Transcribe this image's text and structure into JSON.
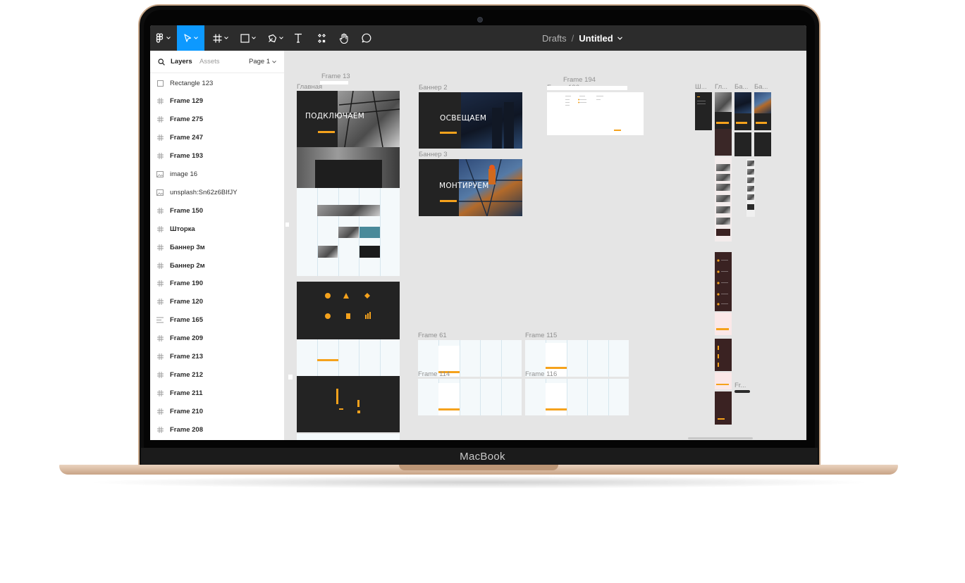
{
  "device": {
    "chin_label": "MacBook"
  },
  "toolbar": {
    "tools": [
      {
        "name": "main-menu",
        "icon": "figma-logo-icon",
        "has_dropdown": true
      },
      {
        "name": "move",
        "icon": "cursor-arrow-icon",
        "has_dropdown": true,
        "active": true
      },
      {
        "name": "frame",
        "icon": "frame-hash-icon",
        "has_dropdown": true
      },
      {
        "name": "shape",
        "icon": "rectangle-icon",
        "has_dropdown": true
      },
      {
        "name": "pen",
        "icon": "pen-icon",
        "has_dropdown": true
      },
      {
        "name": "text",
        "icon": "text-t-icon",
        "has_dropdown": false
      },
      {
        "name": "resources",
        "icon": "components-icon",
        "has_dropdown": false
      },
      {
        "name": "hand",
        "icon": "hand-icon",
        "has_dropdown": false
      },
      {
        "name": "comment",
        "icon": "comment-bubble-icon",
        "has_dropdown": false
      }
    ],
    "breadcrumb": {
      "folder": "Drafts",
      "separator": "/",
      "file": "Untitled"
    },
    "active_color": "#0d99ff"
  },
  "panel": {
    "tab_layers": "Layers",
    "tab_assets": "Assets",
    "page_selector": "Page 1",
    "layers": [
      {
        "name": "Rectangle 123",
        "icon": "rectangle-icon",
        "bold": false
      },
      {
        "name": "Frame 129",
        "icon": "frame-hash-icon",
        "bold": true
      },
      {
        "name": "Frame 275",
        "icon": "frame-hash-icon",
        "bold": true
      },
      {
        "name": "Frame 247",
        "icon": "frame-hash-icon",
        "bold": true
      },
      {
        "name": "Frame 193",
        "icon": "frame-hash-icon",
        "bold": true
      },
      {
        "name": "image 16",
        "icon": "image-icon",
        "bold": false
      },
      {
        "name": "unsplash:Sn62z6BIfJY",
        "icon": "image-icon",
        "bold": false
      },
      {
        "name": "Frame 150",
        "icon": "frame-hash-icon",
        "bold": true
      },
      {
        "name": "Шторка",
        "icon": "frame-hash-icon",
        "bold": true
      },
      {
        "name": "Баннер 3м",
        "icon": "frame-hash-icon",
        "bold": true
      },
      {
        "name": "Баннер 2м",
        "icon": "frame-hash-icon",
        "bold": true
      },
      {
        "name": "Frame 190",
        "icon": "frame-hash-icon",
        "bold": true
      },
      {
        "name": "Frame 120",
        "icon": "frame-hash-icon",
        "bold": true
      },
      {
        "name": "Frame 165",
        "icon": "auto-layout-icon",
        "bold": true
      },
      {
        "name": "Frame 209",
        "icon": "frame-hash-icon",
        "bold": true
      },
      {
        "name": "Frame 213",
        "icon": "frame-hash-icon",
        "bold": true
      },
      {
        "name": "Frame 212",
        "icon": "frame-hash-icon",
        "bold": true
      },
      {
        "name": "Frame 211",
        "icon": "frame-hash-icon",
        "bold": true
      },
      {
        "name": "Frame 210",
        "icon": "frame-hash-icon",
        "bold": true
      },
      {
        "name": "Frame 208",
        "icon": "frame-hash-icon",
        "bold": true
      }
    ]
  },
  "canvas": {
    "frame_labels": {
      "frame13": "Frame 13",
      "glavnaya": "Главная",
      "banner2": "Баннер 2",
      "banner3": "Баннер 3",
      "frame194": "Frame 194",
      "frame_other": "Frame 196",
      "frame61": "Frame 61",
      "frame115": "Frame 115",
      "frame114": "Frame 114",
      "frame116": "Frame 116",
      "sh": "Ш...",
      "gl": "Гл...",
      "ba1": "Ба...",
      "ba2": "Ба...",
      "fr": "Fr..."
    },
    "hero_texts": {
      "main": "ПОДКЛЮЧАЕМ",
      "banner2": "ОСВЕЩАЕМ",
      "banner3": "МОНТИРУЕМ"
    },
    "accent_color": "#f5a21c",
    "dark_color": "#232323"
  }
}
